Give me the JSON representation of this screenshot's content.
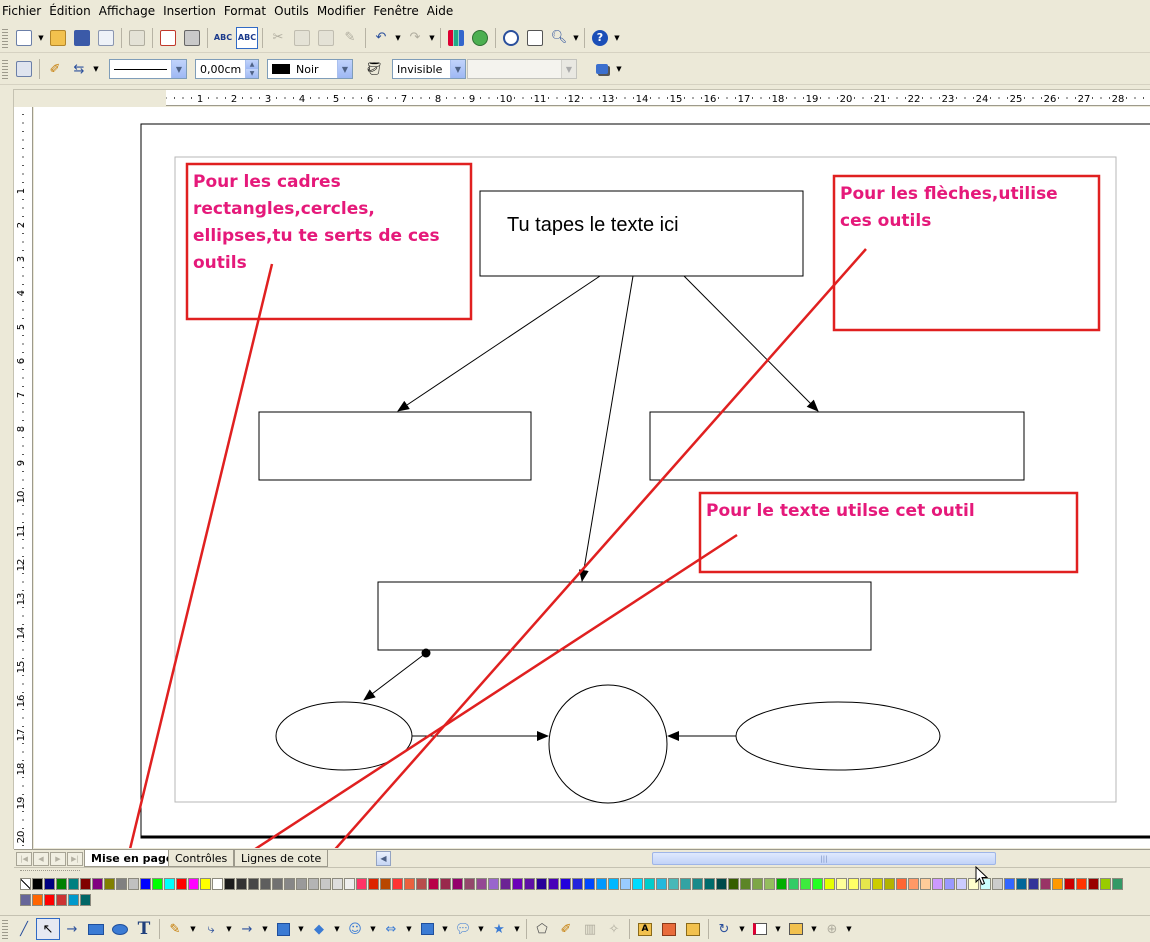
{
  "menu": {
    "items": [
      "Fichier",
      "Édition",
      "Affichage",
      "Insertion",
      "Format",
      "Outils",
      "Modifier",
      "Fenêtre",
      "Aide"
    ]
  },
  "line_toolbar": {
    "line_width": "0,00cm",
    "line_color": "Noir",
    "area_style": "Invisible",
    "area_fill": ""
  },
  "ruler": {
    "h_labels": [
      "4",
      "3",
      "2",
      "1",
      "1",
      "2",
      "3",
      "4",
      "5",
      "6",
      "7",
      "8",
      "9",
      "10",
      "11",
      "12",
      "13",
      "14",
      "15",
      "16",
      "17",
      "18",
      "19",
      "20",
      "21",
      "22",
      "23",
      "24",
      "25",
      "26",
      "27",
      "28"
    ],
    "v_labels": [
      "1",
      "2",
      "3",
      "4",
      "5",
      "6",
      "7",
      "8",
      "9",
      "10",
      "11",
      "12",
      "13",
      "14",
      "15",
      "16",
      "17",
      "18",
      "19",
      "20"
    ]
  },
  "diagram": {
    "top_box_text": "Tu tapes le texte ici",
    "annotations": {
      "shapes": [
        "Pour les cadres",
        "rectangles,cercles,",
        "ellipses,tu te serts de ces",
        "outils"
      ],
      "arrows": [
        "Pour les flèches,utilise",
        "ces outils"
      ],
      "text": [
        "Pour le texte utilse cet outil"
      ]
    }
  },
  "sheet_tabs": {
    "tabs": [
      "Mise en page",
      "Contrôles",
      "Lignes de cote"
    ],
    "active": "Mise en page"
  },
  "colors": {
    "annotation_text": "#e5197a",
    "annotation_border": "#e02020",
    "palette": [
      "#ffffff",
      "#000000",
      "#000080",
      "#008000",
      "#008080",
      "#800000",
      "#800080",
      "#808000",
      "#808080",
      "#c0c0c0",
      "#0000ff",
      "#00ff00",
      "#00ffff",
      "#ff0000",
      "#ff00ff",
      "#ffff00",
      "#ffffff",
      "#1c1c1c",
      "#333333",
      "#474747",
      "#5e5e5e",
      "#717171",
      "#878787",
      "#9a9a9a",
      "#b4b4b4",
      "#c8c8c8",
      "#dddddd",
      "#eeeeee",
      "#ff3366",
      "#dc2300",
      "#b84700",
      "#ff3333",
      "#eb613d",
      "#b84c4c",
      "#b80047",
      "#99284c",
      "#94006b",
      "#94476b",
      "#944794",
      "#9966cc",
      "#6b2394",
      "#6b00b8",
      "#5e11a6",
      "#280099",
      "#4700b8",
      "#2300dc",
      "#2323dc",
      "#0047ff",
      "#0099ff",
      "#00b8ff",
      "#99ccff",
      "#00dcff",
      "#00cccc",
      "#23b8dc",
      "#47b8b8",
      "#33a3a3",
      "#198a8a",
      "#006b6b",
      "#004a4a",
      "#355e00",
      "#5c8526",
      "#7da647",
      "#94bd5e",
      "#00ae00",
      "#33cc66",
      "#3deb3d",
      "#23ff23",
      "#e6ff00",
      "#ffff99",
      "#ffff66",
      "#e6e64c",
      "#cccc00",
      "#b3b300",
      "#ff6633",
      "#ff9966",
      "#ffcc99",
      "#cc99ff",
      "#9999ff",
      "#ccccff",
      "#ffffcc",
      "#ccffff",
      "#cccccc",
      "#3366ff",
      "#006699",
      "#333399",
      "#993366",
      "#ff9900",
      "#cc0000",
      "#ff3300",
      "#990000",
      "#99cc00",
      "#339966",
      "#666699",
      "#ff6600",
      "#ff0000",
      "#cc3333",
      "#0099cc",
      "#006666"
    ]
  }
}
